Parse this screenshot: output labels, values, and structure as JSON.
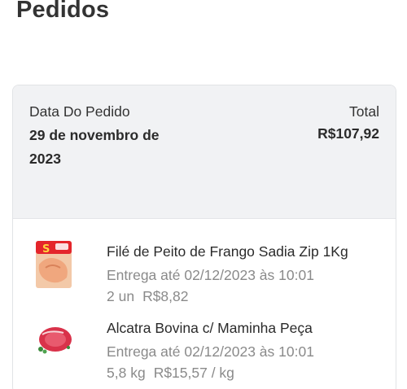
{
  "page": {
    "title": "Pedidos"
  },
  "order": {
    "date_label": "Data Do Pedido",
    "date_value": "29 de novembro de 2023",
    "total_label": "Total",
    "total_value": "R$107,92",
    "items": [
      {
        "name": "Filé de Peito de Frango Sadia Zip 1Kg",
        "delivery": "Entrega até 02/12/2023 às 10:01",
        "quantity": "2 un",
        "price": "R$8,82",
        "icon": "chicken-breast-package-image"
      },
      {
        "name": "Alcatra Bovina c/ Maminha Peça",
        "delivery": "Entrega até 02/12/2023 às 10:01",
        "quantity": "5,8 kg",
        "price": "R$15,57 / kg",
        "icon": "beef-cut-image"
      }
    ]
  },
  "colors": {
    "header_bg": "#f1f2f4",
    "muted_text": "#8a8a8a",
    "brand_red": "#e4252b"
  }
}
